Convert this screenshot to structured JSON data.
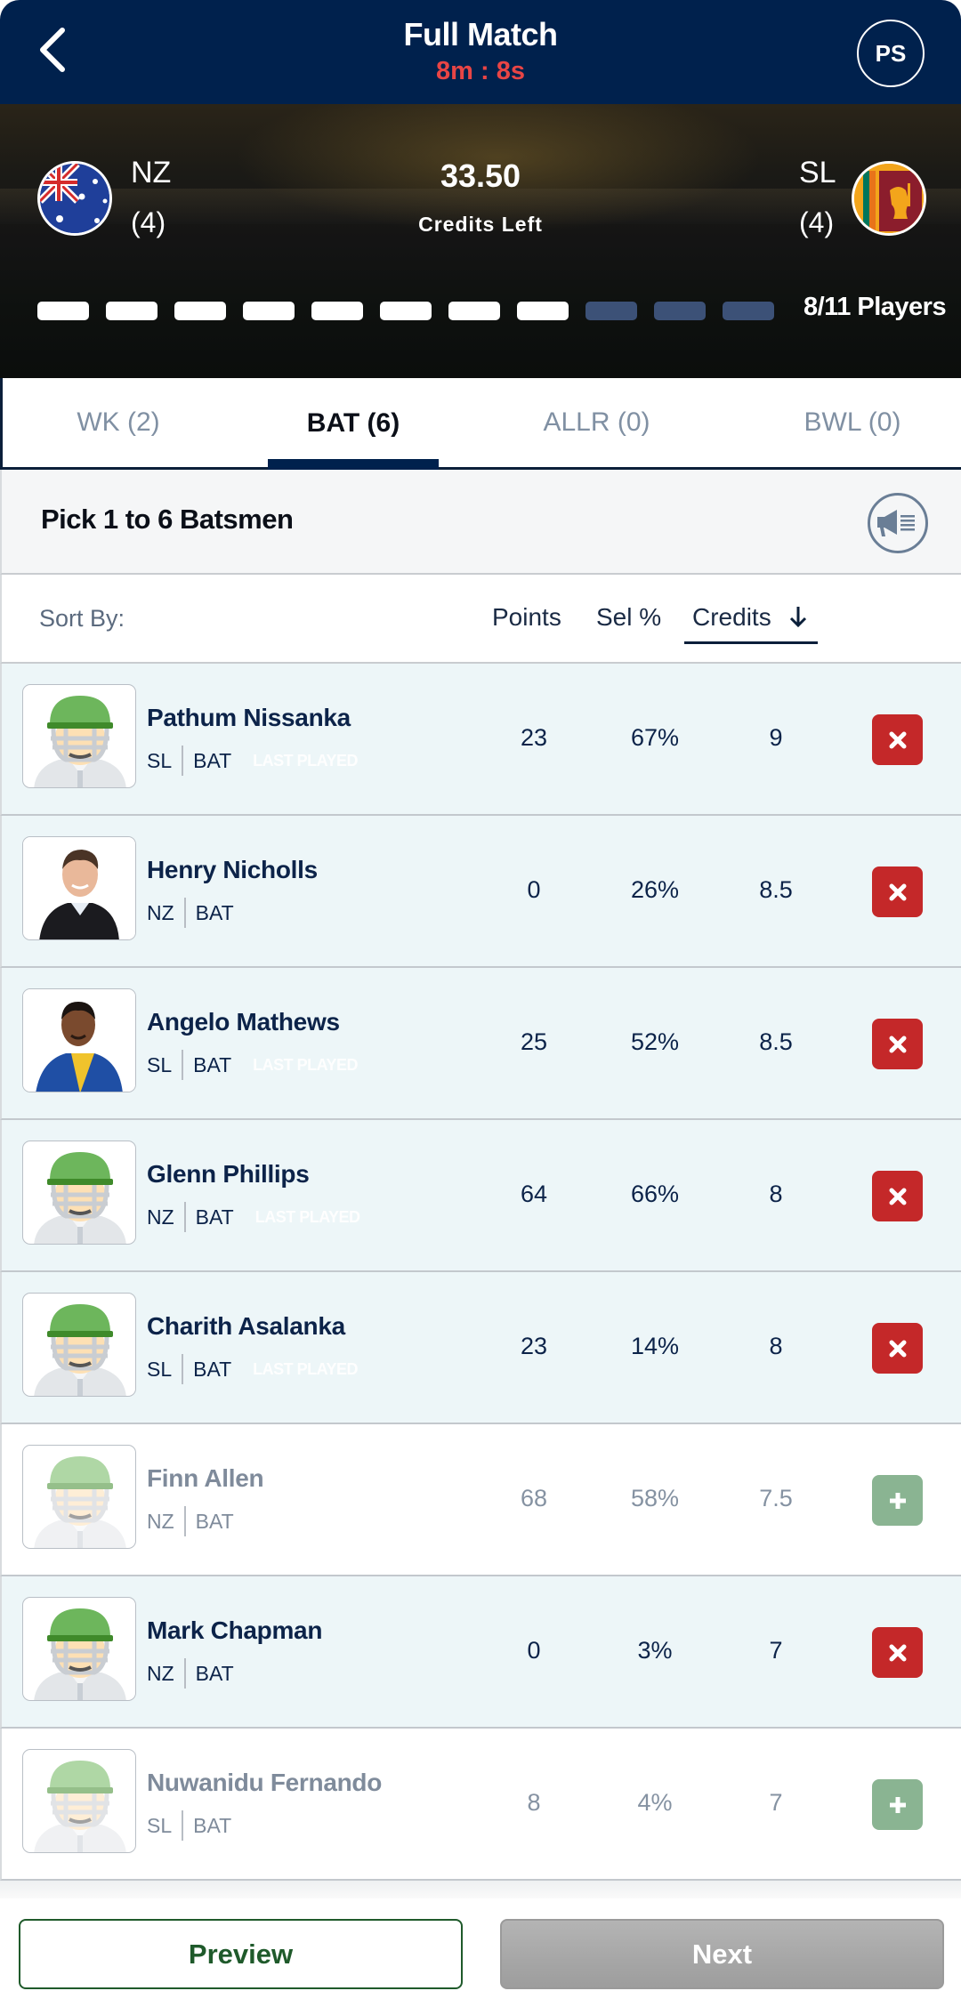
{
  "header": {
    "title": "Full Match",
    "timer": "8m : 8s",
    "profile_initials": "PS"
  },
  "banner": {
    "team_left": {
      "code": "NZ",
      "count": "(4)",
      "flag_icon": "australia-flag-icon"
    },
    "team_right": {
      "code": "SL",
      "count": "(4)",
      "flag_icon": "sri-lanka-flag-icon"
    },
    "credits_left_value": "33.50",
    "credits_left_label": "Credits Left",
    "players_selected": 8,
    "players_total": 11,
    "players_label": "8/11 Players"
  },
  "tabs": [
    {
      "label": "WK  (2)",
      "active": false
    },
    {
      "label": "BAT  (6)",
      "active": true
    },
    {
      "label": "ALLR  (0)",
      "active": false
    },
    {
      "label": "BWL  (0)",
      "active": false
    }
  ],
  "info": {
    "text": "Pick 1 to 6 Batsmen",
    "announce_icon": "megaphone-icon"
  },
  "sort": {
    "label": "Sort By:",
    "options": [
      "Points",
      "Sel %",
      "Credits"
    ],
    "active": "Credits",
    "direction": "descending"
  },
  "players": [
    {
      "name": "Pathum Nissanka",
      "team": "SL",
      "role": "BAT",
      "last_played": "LAST PLAYED",
      "points": "23",
      "sel": "67%",
      "credits": "9",
      "selected": true,
      "photo": "placeholder"
    },
    {
      "name": "Henry Nicholls",
      "team": "NZ",
      "role": "BAT",
      "last_played": "",
      "points": "0",
      "sel": "26%",
      "credits": "8.5",
      "selected": true,
      "photo": "nz-player"
    },
    {
      "name": "Angelo Mathews",
      "team": "SL",
      "role": "BAT",
      "last_played": "LAST PLAYED",
      "points": "25",
      "sel": "52%",
      "credits": "8.5",
      "selected": true,
      "photo": "sl-player"
    },
    {
      "name": "Glenn Phillips",
      "team": "NZ",
      "role": "BAT",
      "last_played": "LAST PLAYED",
      "points": "64",
      "sel": "66%",
      "credits": "8",
      "selected": true,
      "photo": "placeholder"
    },
    {
      "name": "Charith Asalanka",
      "team": "SL",
      "role": "BAT",
      "last_played": "LAST PLAYED",
      "points": "23",
      "sel": "14%",
      "credits": "8",
      "selected": true,
      "photo": "placeholder"
    },
    {
      "name": "Finn Allen",
      "team": "NZ",
      "role": "BAT",
      "last_played": "",
      "points": "68",
      "sel": "58%",
      "credits": "7.5",
      "selected": false,
      "photo": "placeholder"
    },
    {
      "name": "Mark Chapman",
      "team": "NZ",
      "role": "BAT",
      "last_played": "",
      "points": "0",
      "sel": "3%",
      "credits": "7",
      "selected": true,
      "photo": "placeholder"
    },
    {
      "name": "Nuwanidu Fernando",
      "team": "SL",
      "role": "BAT",
      "last_played": "",
      "points": "8",
      "sel": "4%",
      "credits": "7",
      "selected": false,
      "photo": "placeholder"
    }
  ],
  "footer": {
    "preview_label": "Preview",
    "next_label": "Next"
  }
}
